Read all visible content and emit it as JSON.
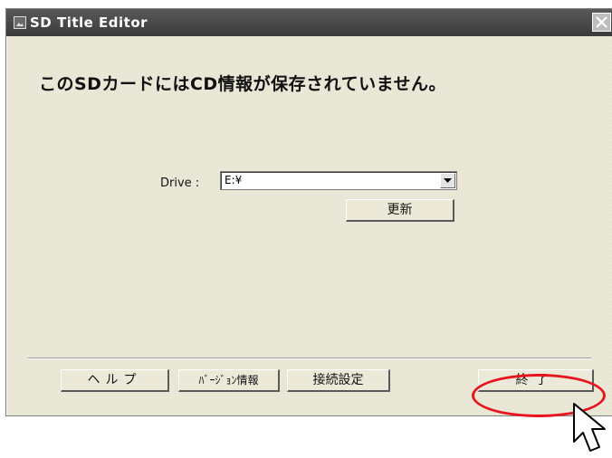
{
  "window": {
    "title": "SD Title Editor"
  },
  "message": "このSDカードにはCD情報が保存されていません。",
  "drive": {
    "label": "Drive :",
    "selected": "E:¥"
  },
  "buttons": {
    "refresh": "更新",
    "help": "ヘルプ",
    "version": "ﾊﾞｰｼﾞｮﾝ情報",
    "connection": "接続設定",
    "exit": "終了"
  },
  "icons": {
    "app": "app-image-icon",
    "close": "close-icon",
    "dropdown": "chevron-down-icon",
    "cursor": "mouse-pointer-icon"
  },
  "colors": {
    "titlebar": "#3a3a3a",
    "dialog_bg": "#ece9d8",
    "highlight": "#e8141e"
  }
}
